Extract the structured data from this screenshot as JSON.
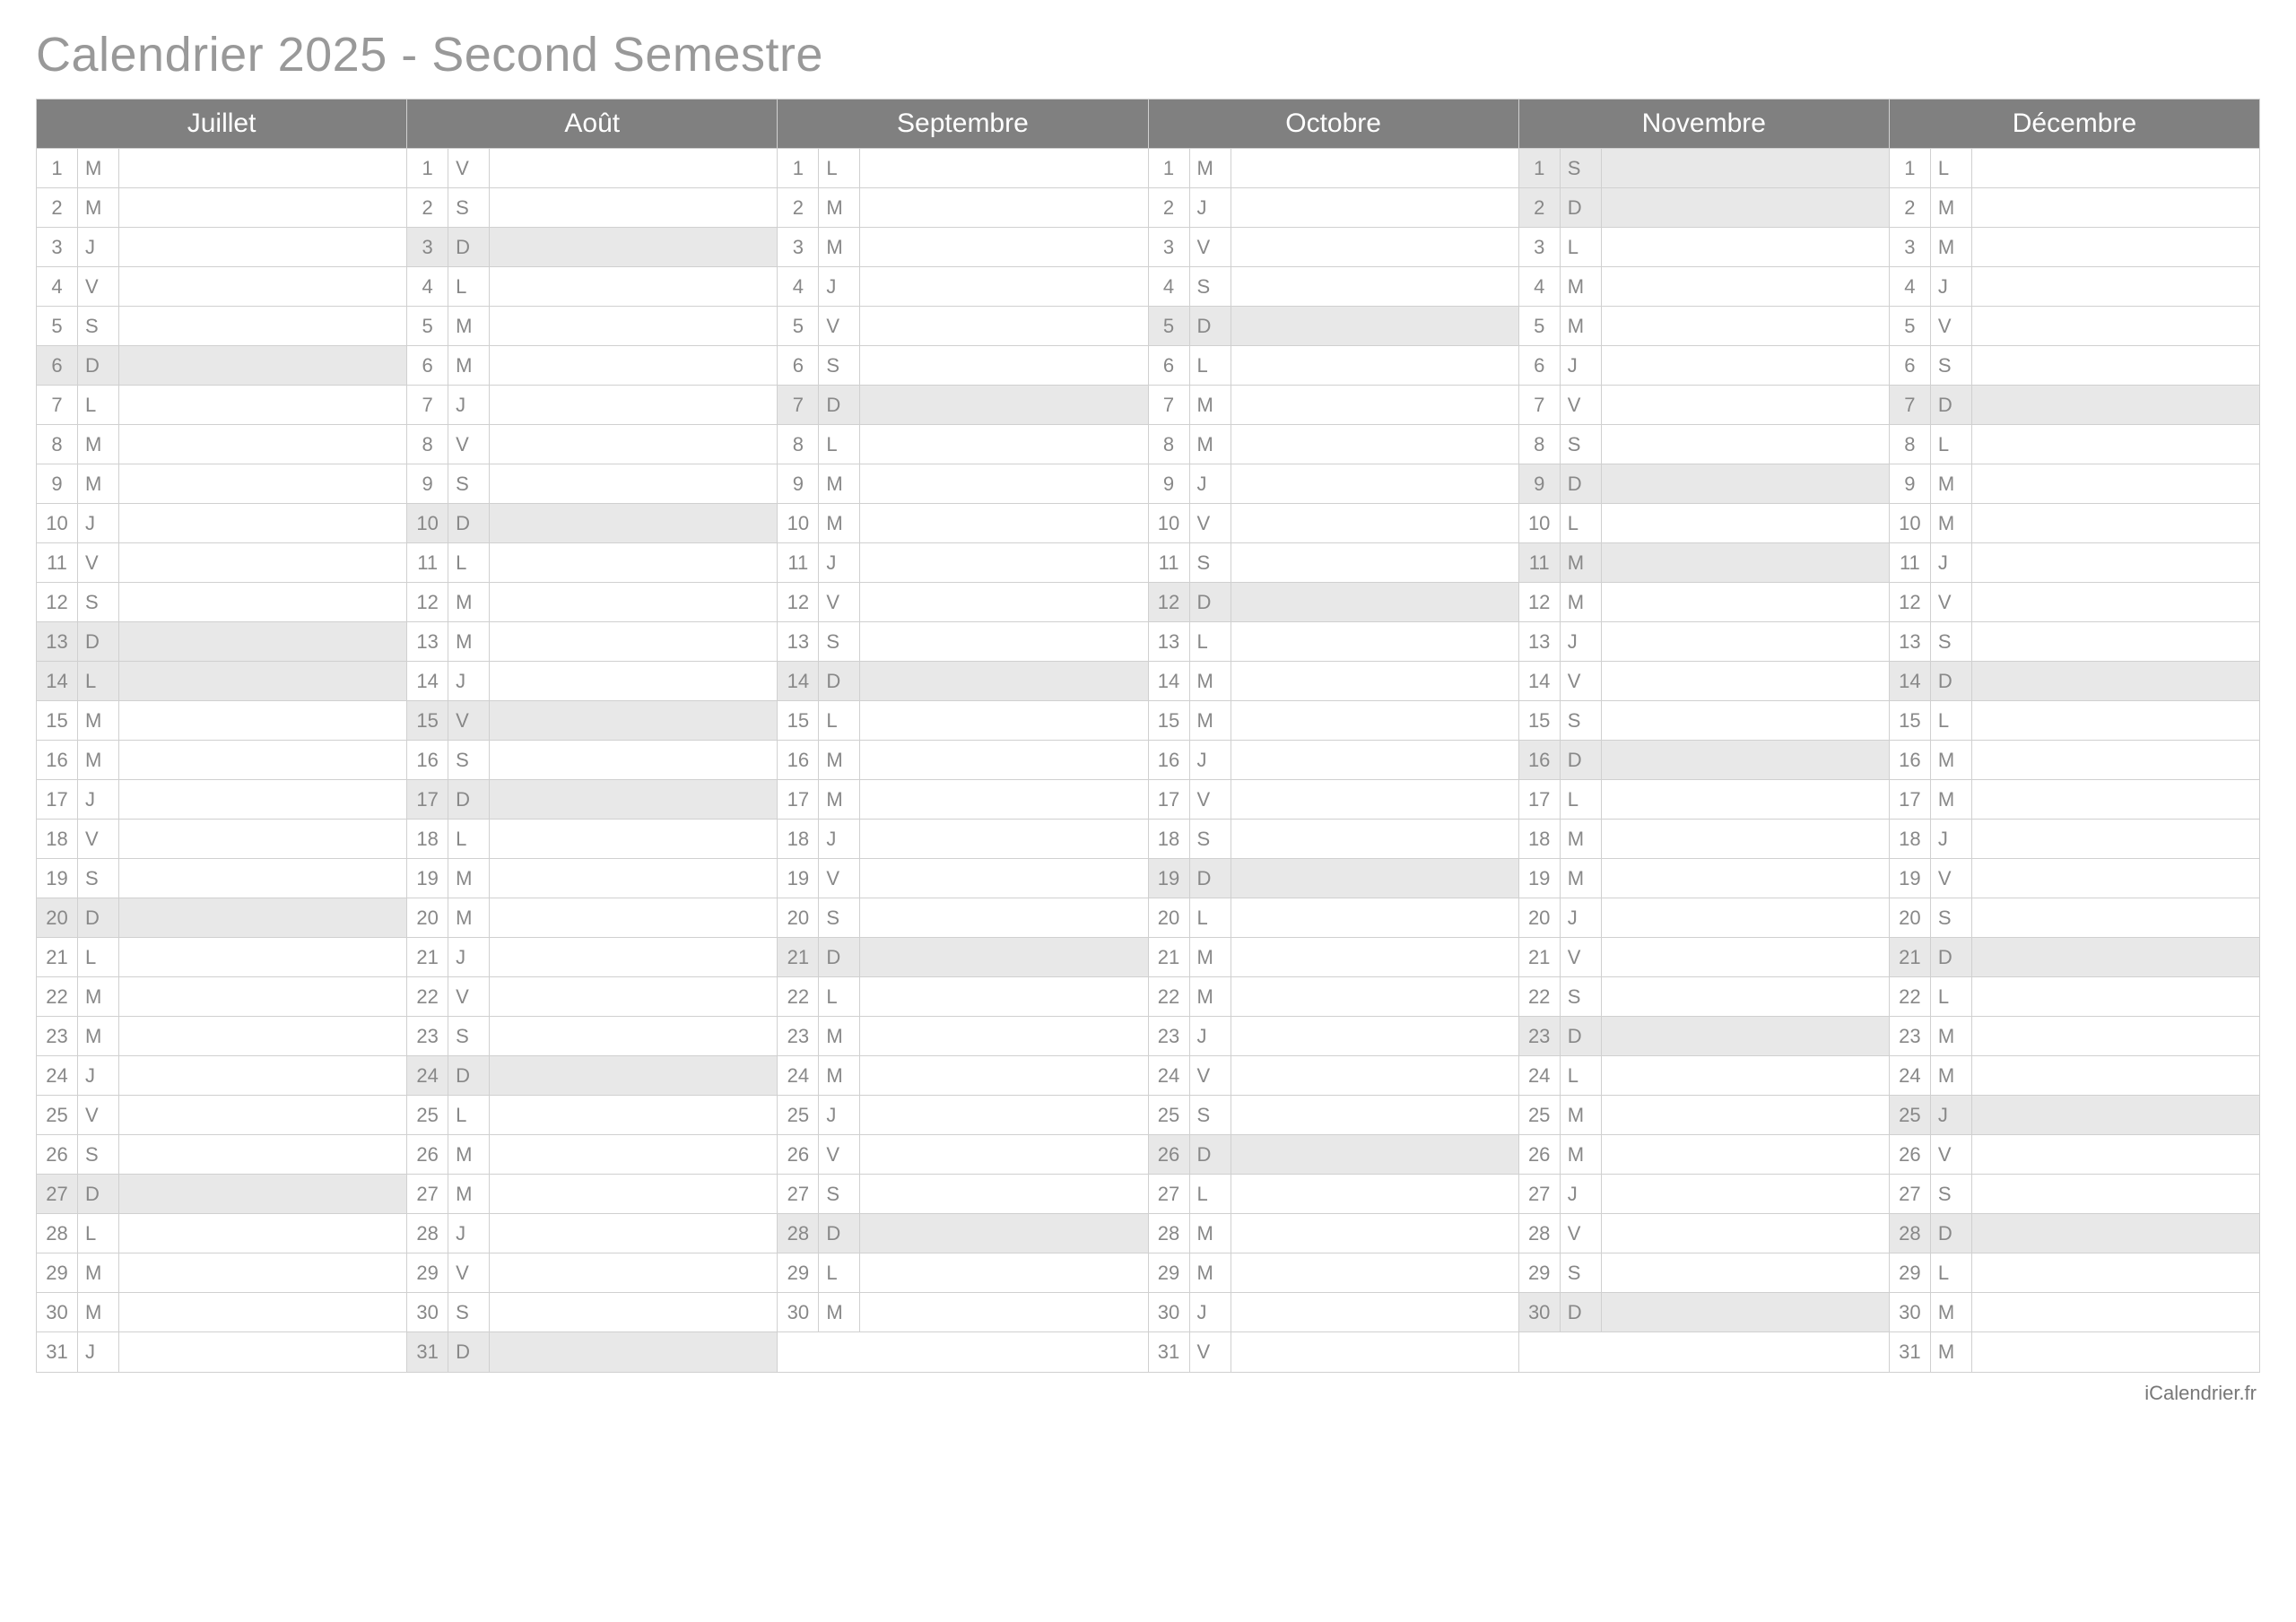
{
  "title": "Calendrier 2025 - Second Semestre",
  "footer": "iCalendrier.fr",
  "months": [
    {
      "name": "Juillet",
      "days": [
        {
          "n": 1,
          "w": "M",
          "s": false
        },
        {
          "n": 2,
          "w": "M",
          "s": false
        },
        {
          "n": 3,
          "w": "J",
          "s": false
        },
        {
          "n": 4,
          "w": "V",
          "s": false
        },
        {
          "n": 5,
          "w": "S",
          "s": false
        },
        {
          "n": 6,
          "w": "D",
          "s": true
        },
        {
          "n": 7,
          "w": "L",
          "s": false
        },
        {
          "n": 8,
          "w": "M",
          "s": false
        },
        {
          "n": 9,
          "w": "M",
          "s": false
        },
        {
          "n": 10,
          "w": "J",
          "s": false
        },
        {
          "n": 11,
          "w": "V",
          "s": false
        },
        {
          "n": 12,
          "w": "S",
          "s": false
        },
        {
          "n": 13,
          "w": "D",
          "s": true
        },
        {
          "n": 14,
          "w": "L",
          "s": true
        },
        {
          "n": 15,
          "w": "M",
          "s": false
        },
        {
          "n": 16,
          "w": "M",
          "s": false
        },
        {
          "n": 17,
          "w": "J",
          "s": false
        },
        {
          "n": 18,
          "w": "V",
          "s": false
        },
        {
          "n": 19,
          "w": "S",
          "s": false
        },
        {
          "n": 20,
          "w": "D",
          "s": true
        },
        {
          "n": 21,
          "w": "L",
          "s": false
        },
        {
          "n": 22,
          "w": "M",
          "s": false
        },
        {
          "n": 23,
          "w": "M",
          "s": false
        },
        {
          "n": 24,
          "w": "J",
          "s": false
        },
        {
          "n": 25,
          "w": "V",
          "s": false
        },
        {
          "n": 26,
          "w": "S",
          "s": false
        },
        {
          "n": 27,
          "w": "D",
          "s": true
        },
        {
          "n": 28,
          "w": "L",
          "s": false
        },
        {
          "n": 29,
          "w": "M",
          "s": false
        },
        {
          "n": 30,
          "w": "M",
          "s": false
        },
        {
          "n": 31,
          "w": "J",
          "s": false
        }
      ]
    },
    {
      "name": "Août",
      "days": [
        {
          "n": 1,
          "w": "V",
          "s": false
        },
        {
          "n": 2,
          "w": "S",
          "s": false
        },
        {
          "n": 3,
          "w": "D",
          "s": true
        },
        {
          "n": 4,
          "w": "L",
          "s": false
        },
        {
          "n": 5,
          "w": "M",
          "s": false
        },
        {
          "n": 6,
          "w": "M",
          "s": false
        },
        {
          "n": 7,
          "w": "J",
          "s": false
        },
        {
          "n": 8,
          "w": "V",
          "s": false
        },
        {
          "n": 9,
          "w": "S",
          "s": false
        },
        {
          "n": 10,
          "w": "D",
          "s": true
        },
        {
          "n": 11,
          "w": "L",
          "s": false
        },
        {
          "n": 12,
          "w": "M",
          "s": false
        },
        {
          "n": 13,
          "w": "M",
          "s": false
        },
        {
          "n": 14,
          "w": "J",
          "s": false
        },
        {
          "n": 15,
          "w": "V",
          "s": true
        },
        {
          "n": 16,
          "w": "S",
          "s": false
        },
        {
          "n": 17,
          "w": "D",
          "s": true
        },
        {
          "n": 18,
          "w": "L",
          "s": false
        },
        {
          "n": 19,
          "w": "M",
          "s": false
        },
        {
          "n": 20,
          "w": "M",
          "s": false
        },
        {
          "n": 21,
          "w": "J",
          "s": false
        },
        {
          "n": 22,
          "w": "V",
          "s": false
        },
        {
          "n": 23,
          "w": "S",
          "s": false
        },
        {
          "n": 24,
          "w": "D",
          "s": true
        },
        {
          "n": 25,
          "w": "L",
          "s": false
        },
        {
          "n": 26,
          "w": "M",
          "s": false
        },
        {
          "n": 27,
          "w": "M",
          "s": false
        },
        {
          "n": 28,
          "w": "J",
          "s": false
        },
        {
          "n": 29,
          "w": "V",
          "s": false
        },
        {
          "n": 30,
          "w": "S",
          "s": false
        },
        {
          "n": 31,
          "w": "D",
          "s": true
        }
      ]
    },
    {
      "name": "Septembre",
      "days": [
        {
          "n": 1,
          "w": "L",
          "s": false
        },
        {
          "n": 2,
          "w": "M",
          "s": false
        },
        {
          "n": 3,
          "w": "M",
          "s": false
        },
        {
          "n": 4,
          "w": "J",
          "s": false
        },
        {
          "n": 5,
          "w": "V",
          "s": false
        },
        {
          "n": 6,
          "w": "S",
          "s": false
        },
        {
          "n": 7,
          "w": "D",
          "s": true
        },
        {
          "n": 8,
          "w": "L",
          "s": false
        },
        {
          "n": 9,
          "w": "M",
          "s": false
        },
        {
          "n": 10,
          "w": "M",
          "s": false
        },
        {
          "n": 11,
          "w": "J",
          "s": false
        },
        {
          "n": 12,
          "w": "V",
          "s": false
        },
        {
          "n": 13,
          "w": "S",
          "s": false
        },
        {
          "n": 14,
          "w": "D",
          "s": true
        },
        {
          "n": 15,
          "w": "L",
          "s": false
        },
        {
          "n": 16,
          "w": "M",
          "s": false
        },
        {
          "n": 17,
          "w": "M",
          "s": false
        },
        {
          "n": 18,
          "w": "J",
          "s": false
        },
        {
          "n": 19,
          "w": "V",
          "s": false
        },
        {
          "n": 20,
          "w": "S",
          "s": false
        },
        {
          "n": 21,
          "w": "D",
          "s": true
        },
        {
          "n": 22,
          "w": "L",
          "s": false
        },
        {
          "n": 23,
          "w": "M",
          "s": false
        },
        {
          "n": 24,
          "w": "M",
          "s": false
        },
        {
          "n": 25,
          "w": "J",
          "s": false
        },
        {
          "n": 26,
          "w": "V",
          "s": false
        },
        {
          "n": 27,
          "w": "S",
          "s": false
        },
        {
          "n": 28,
          "w": "D",
          "s": true
        },
        {
          "n": 29,
          "w": "L",
          "s": false
        },
        {
          "n": 30,
          "w": "M",
          "s": false
        }
      ]
    },
    {
      "name": "Octobre",
      "days": [
        {
          "n": 1,
          "w": "M",
          "s": false
        },
        {
          "n": 2,
          "w": "J",
          "s": false
        },
        {
          "n": 3,
          "w": "V",
          "s": false
        },
        {
          "n": 4,
          "w": "S",
          "s": false
        },
        {
          "n": 5,
          "w": "D",
          "s": true
        },
        {
          "n": 6,
          "w": "L",
          "s": false
        },
        {
          "n": 7,
          "w": "M",
          "s": false
        },
        {
          "n": 8,
          "w": "M",
          "s": false
        },
        {
          "n": 9,
          "w": "J",
          "s": false
        },
        {
          "n": 10,
          "w": "V",
          "s": false
        },
        {
          "n": 11,
          "w": "S",
          "s": false
        },
        {
          "n": 12,
          "w": "D",
          "s": true
        },
        {
          "n": 13,
          "w": "L",
          "s": false
        },
        {
          "n": 14,
          "w": "M",
          "s": false
        },
        {
          "n": 15,
          "w": "M",
          "s": false
        },
        {
          "n": 16,
          "w": "J",
          "s": false
        },
        {
          "n": 17,
          "w": "V",
          "s": false
        },
        {
          "n": 18,
          "w": "S",
          "s": false
        },
        {
          "n": 19,
          "w": "D",
          "s": true
        },
        {
          "n": 20,
          "w": "L",
          "s": false
        },
        {
          "n": 21,
          "w": "M",
          "s": false
        },
        {
          "n": 22,
          "w": "M",
          "s": false
        },
        {
          "n": 23,
          "w": "J",
          "s": false
        },
        {
          "n": 24,
          "w": "V",
          "s": false
        },
        {
          "n": 25,
          "w": "S",
          "s": false
        },
        {
          "n": 26,
          "w": "D",
          "s": true
        },
        {
          "n": 27,
          "w": "L",
          "s": false
        },
        {
          "n": 28,
          "w": "M",
          "s": false
        },
        {
          "n": 29,
          "w": "M",
          "s": false
        },
        {
          "n": 30,
          "w": "J",
          "s": false
        },
        {
          "n": 31,
          "w": "V",
          "s": false
        }
      ]
    },
    {
      "name": "Novembre",
      "days": [
        {
          "n": 1,
          "w": "S",
          "s": true
        },
        {
          "n": 2,
          "w": "D",
          "s": true
        },
        {
          "n": 3,
          "w": "L",
          "s": false
        },
        {
          "n": 4,
          "w": "M",
          "s": false
        },
        {
          "n": 5,
          "w": "M",
          "s": false
        },
        {
          "n": 6,
          "w": "J",
          "s": false
        },
        {
          "n": 7,
          "w": "V",
          "s": false
        },
        {
          "n": 8,
          "w": "S",
          "s": false
        },
        {
          "n": 9,
          "w": "D",
          "s": true
        },
        {
          "n": 10,
          "w": "L",
          "s": false
        },
        {
          "n": 11,
          "w": "M",
          "s": true
        },
        {
          "n": 12,
          "w": "M",
          "s": false
        },
        {
          "n": 13,
          "w": "J",
          "s": false
        },
        {
          "n": 14,
          "w": "V",
          "s": false
        },
        {
          "n": 15,
          "w": "S",
          "s": false
        },
        {
          "n": 16,
          "w": "D",
          "s": true
        },
        {
          "n": 17,
          "w": "L",
          "s": false
        },
        {
          "n": 18,
          "w": "M",
          "s": false
        },
        {
          "n": 19,
          "w": "M",
          "s": false
        },
        {
          "n": 20,
          "w": "J",
          "s": false
        },
        {
          "n": 21,
          "w": "V",
          "s": false
        },
        {
          "n": 22,
          "w": "S",
          "s": false
        },
        {
          "n": 23,
          "w": "D",
          "s": true
        },
        {
          "n": 24,
          "w": "L",
          "s": false
        },
        {
          "n": 25,
          "w": "M",
          "s": false
        },
        {
          "n": 26,
          "w": "M",
          "s": false
        },
        {
          "n": 27,
          "w": "J",
          "s": false
        },
        {
          "n": 28,
          "w": "V",
          "s": false
        },
        {
          "n": 29,
          "w": "S",
          "s": false
        },
        {
          "n": 30,
          "w": "D",
          "s": true
        }
      ]
    },
    {
      "name": "Décembre",
      "days": [
        {
          "n": 1,
          "w": "L",
          "s": false
        },
        {
          "n": 2,
          "w": "M",
          "s": false
        },
        {
          "n": 3,
          "w": "M",
          "s": false
        },
        {
          "n": 4,
          "w": "J",
          "s": false
        },
        {
          "n": 5,
          "w": "V",
          "s": false
        },
        {
          "n": 6,
          "w": "S",
          "s": false
        },
        {
          "n": 7,
          "w": "D",
          "s": true
        },
        {
          "n": 8,
          "w": "L",
          "s": false
        },
        {
          "n": 9,
          "w": "M",
          "s": false
        },
        {
          "n": 10,
          "w": "M",
          "s": false
        },
        {
          "n": 11,
          "w": "J",
          "s": false
        },
        {
          "n": 12,
          "w": "V",
          "s": false
        },
        {
          "n": 13,
          "w": "S",
          "s": false
        },
        {
          "n": 14,
          "w": "D",
          "s": true
        },
        {
          "n": 15,
          "w": "L",
          "s": false
        },
        {
          "n": 16,
          "w": "M",
          "s": false
        },
        {
          "n": 17,
          "w": "M",
          "s": false
        },
        {
          "n": 18,
          "w": "J",
          "s": false
        },
        {
          "n": 19,
          "w": "V",
          "s": false
        },
        {
          "n": 20,
          "w": "S",
          "s": false
        },
        {
          "n": 21,
          "w": "D",
          "s": true
        },
        {
          "n": 22,
          "w": "L",
          "s": false
        },
        {
          "n": 23,
          "w": "M",
          "s": false
        },
        {
          "n": 24,
          "w": "M",
          "s": false
        },
        {
          "n": 25,
          "w": "J",
          "s": true
        },
        {
          "n": 26,
          "w": "V",
          "s": false
        },
        {
          "n": 27,
          "w": "S",
          "s": false
        },
        {
          "n": 28,
          "w": "D",
          "s": true
        },
        {
          "n": 29,
          "w": "L",
          "s": false
        },
        {
          "n": 30,
          "w": "M",
          "s": false
        },
        {
          "n": 31,
          "w": "M",
          "s": false
        }
      ]
    }
  ]
}
